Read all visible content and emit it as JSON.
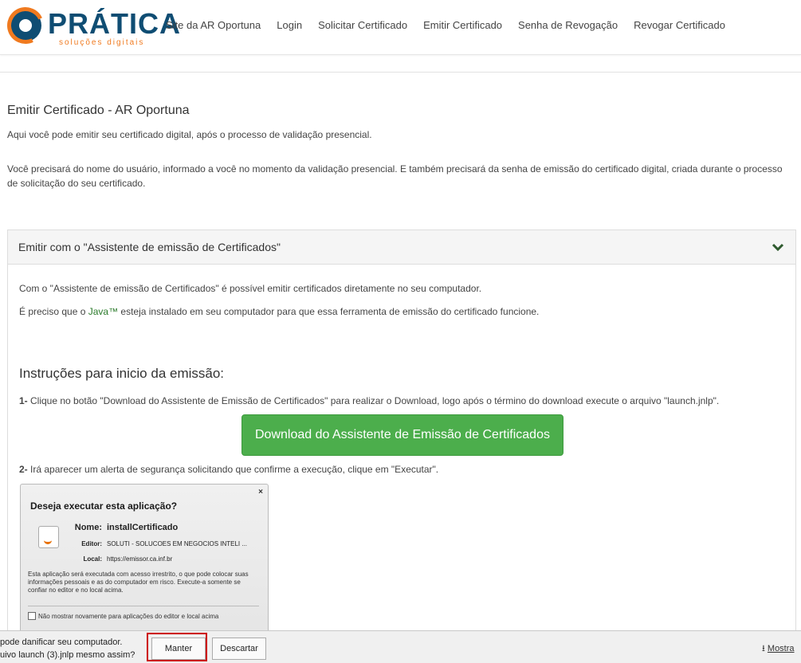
{
  "header": {
    "logo_word": "PRÁTICA",
    "logo_sub": "soluções digitais",
    "nav": [
      "Site da AR Oportuna",
      "Login",
      "Solicitar Certificado",
      "Emitir Certificado",
      "Senha de Revogação",
      "Revogar Certificado"
    ]
  },
  "main": {
    "title": "Emitir Certificado - AR Oportuna",
    "intro": "Aqui você pode emitir seu certificado digital, após o processo de validação presencial.",
    "note": "Você precisará do nome do usuário, informado a você no momento da validação presencial. E também precisará da senha de emissão do certificado digital, criada durante o processo de solicitação do seu certificado."
  },
  "panel": {
    "title": "Emitir com o \"Assistente de emissão de Certificados\"",
    "line1": "Com o \"Assistente de emissão de Certificados\" é possível emitir certificados diretamente no seu computador.",
    "line2_pre": "É preciso que o ",
    "line2_java": "Java™",
    "line2_post": " esteja instalado em seu computador para que essa ferramenta de emissão do certificado funcione.",
    "instr_title": "Instruções para inicio da emissão:",
    "step1_num": "1-",
    "step1_text": " Clique no botão \"Download do Assistente de Emissão de Certificados\" para realizar o Download, logo após o término do download execute o arquivo \"launch.jnlp\".",
    "download_button": "Download do Assistente de Emissão de Certificados",
    "step2_num": "2-",
    "step2_text": " Irá aparecer um alerta de segurança solicitando que confirme a execução, clique em \"Executar\"."
  },
  "java_dialog": {
    "close": "×",
    "title": "Deseja executar esta aplicação?",
    "name_label": "Nome:",
    "name_value": "installCertificado",
    "publisher_label": "Editor:",
    "publisher_value": "SOLUTI - SOLUCOES EM NEGOCIOS INTELI ...",
    "location_label": "Local:",
    "location_value": "https://emissor.ca.inf.br",
    "warning": "Esta aplicação será executada com acesso irrestrito, o que pode colocar suas informações pessoais e as do computador em risco. Execute-a somente se confiar no editor e no local acima.",
    "checkbox": "Não mostrar novamente para aplicações do editor e local acima"
  },
  "download_bar": {
    "warning_line1": "pode danificar seu computador.",
    "warning_line2": "uivo launch (3).jnlp mesmo assim?",
    "keep": "Manter",
    "discard": "Descartar",
    "show_all": "Mostra"
  }
}
